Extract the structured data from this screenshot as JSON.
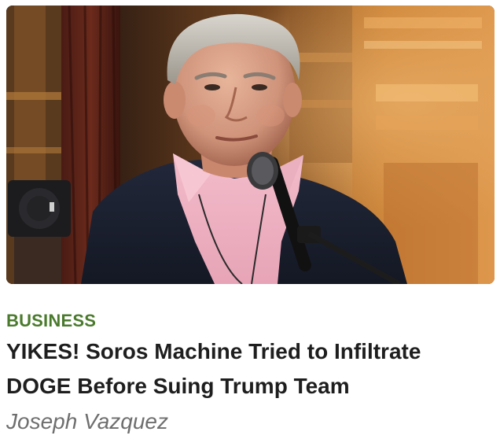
{
  "article": {
    "category": "BUSINESS",
    "headline": "YIKES! Soros Machine Tried to Infiltrate DOGE Before Suing Trump Team",
    "author": "Joseph Vazquez"
  },
  "colors": {
    "category": "#4a7a2c",
    "headline": "#1e1e1e",
    "author": "#6e6e6e"
  }
}
